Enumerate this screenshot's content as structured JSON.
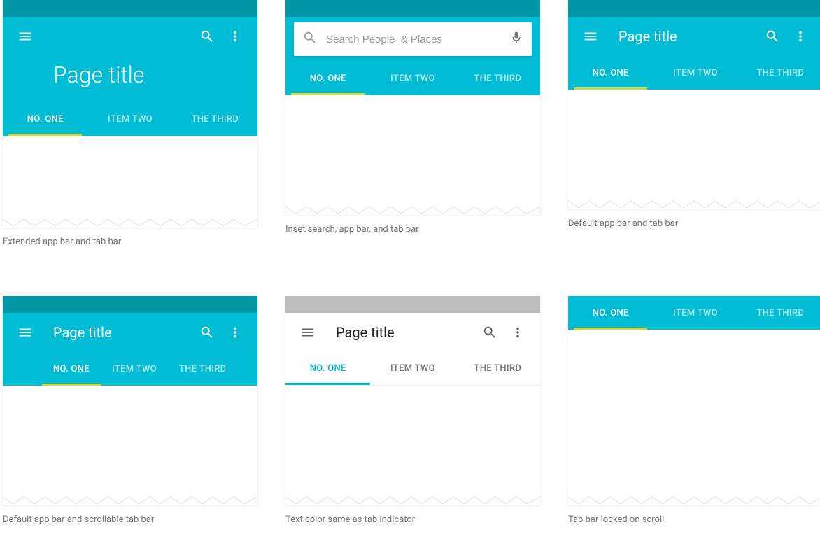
{
  "colors": {
    "primary": "#00bcd4",
    "primaryDark": "#0097a7",
    "accent": "#cddc39",
    "textLight": "#ffffff",
    "textDark": "#212121",
    "muted": "#757575"
  },
  "examples": [
    {
      "id": "extended",
      "title": "Page title",
      "tabs": [
        "NO. ONE",
        "ITEM TWO",
        "THE THIRD"
      ],
      "activeTab": 0,
      "caption": "Extended app bar and tab bar"
    },
    {
      "id": "inset-search",
      "search": {
        "placeholder": "Search People  & Places"
      },
      "tabs": [
        "NO. ONE",
        "ITEM TWO",
        "THE THIRD"
      ],
      "activeTab": 0,
      "caption": "Inset search, app bar, and tab bar"
    },
    {
      "id": "default",
      "title": "Page title",
      "tabs": [
        "NO. ONE",
        "ITEM TWO",
        "THE THIRD"
      ],
      "activeTab": 0,
      "caption": "Default app bar and tab bar"
    },
    {
      "id": "scrollable",
      "title": "Page title",
      "tabs": [
        "NO. ONE",
        "ITEM TWO",
        "THE THIRD"
      ],
      "activeTab": 0,
      "caption": "Default app bar and scrollable tab bar"
    },
    {
      "id": "light",
      "title": "Page title",
      "tabs": [
        "NO. ONE",
        "ITEM TWO",
        "THE THIRD"
      ],
      "activeTab": 0,
      "caption": "Text color same as tab indicator"
    },
    {
      "id": "locked",
      "tabs": [
        "NO. ONE",
        "ITEM TWO",
        "THE THIRD"
      ],
      "activeTab": 0,
      "caption": "Tab bar locked on scroll"
    }
  ]
}
